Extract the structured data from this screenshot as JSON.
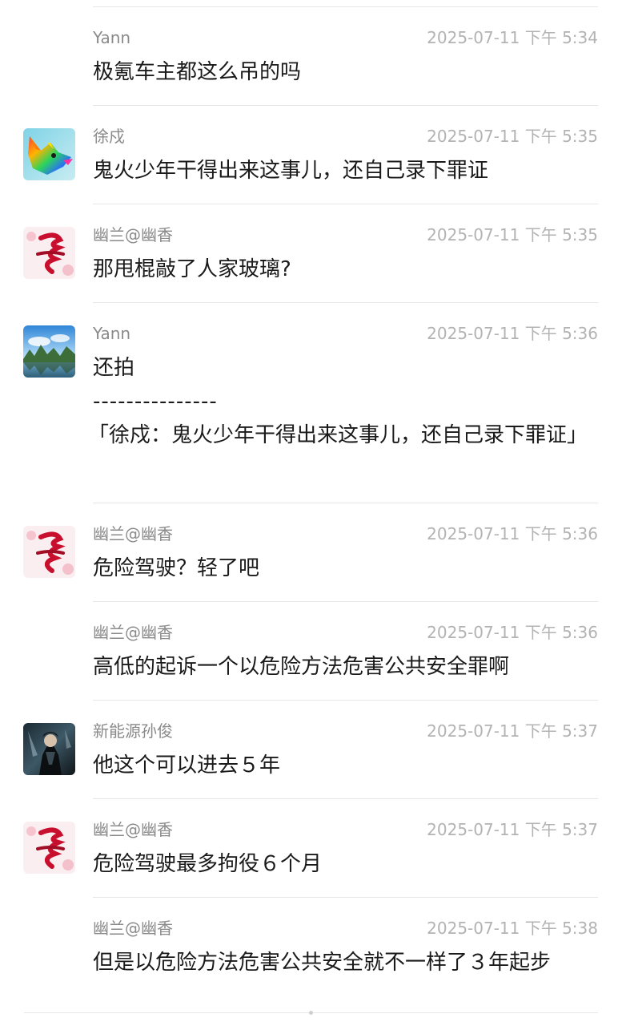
{
  "messages": [
    {
      "sender": "Yann",
      "time": "2025-07-11 下午 5:34",
      "text": "极氪车主都这么吊的吗",
      "avatar": null
    },
    {
      "sender": "徐戍",
      "time": "2025-07-11 下午 5:35",
      "text": "鬼火少年干得出来这事儿，还自己录下罪证",
      "avatar": "colorful-fox-avatar"
    },
    {
      "sender": "幽兰@幽香",
      "time": "2025-07-11 下午 5:35",
      "text": "那甩棍敲了人家玻璃?",
      "avatar": "red-calligraphy-avatar"
    },
    {
      "sender": "Yann",
      "time": "2025-07-11 下午 5:36",
      "text": "还拍",
      "separator": "---------------",
      "quote": "「徐戍：鬼火少年干得出来这事儿，还自己录下罪证」",
      "avatar": "landscape-avatar"
    },
    {
      "sender": "幽兰@幽香",
      "time": "2025-07-11 下午 5:36",
      "text": "危险驾驶？轻了吧",
      "avatar": "red-calligraphy-avatar"
    },
    {
      "sender": "幽兰@幽香",
      "time": "2025-07-11 下午 5:36",
      "text": "高低的起诉一个以危险方法危害公共安全罪啊",
      "avatar": null
    },
    {
      "sender": "新能源孙俊",
      "time": "2025-07-11 下午 5:37",
      "text": "他这个可以进去５年",
      "avatar": "dark-warrior-avatar"
    },
    {
      "sender": "幽兰@幽香",
      "time": "2025-07-11 下午 5:37",
      "text": "危险驾驶最多拘役６个月",
      "avatar": "red-calligraphy-avatar"
    },
    {
      "sender": "幽兰@幽香",
      "time": "2025-07-11 下午 5:38",
      "text": "但是以危险方法危害公共安全就不一样了３年起步",
      "avatar": null
    }
  ],
  "colors": {
    "sender": "#8a8a8a",
    "time": "#b3b3b3",
    "text": "#1a1a1a",
    "divider": "#e6e6e6"
  }
}
